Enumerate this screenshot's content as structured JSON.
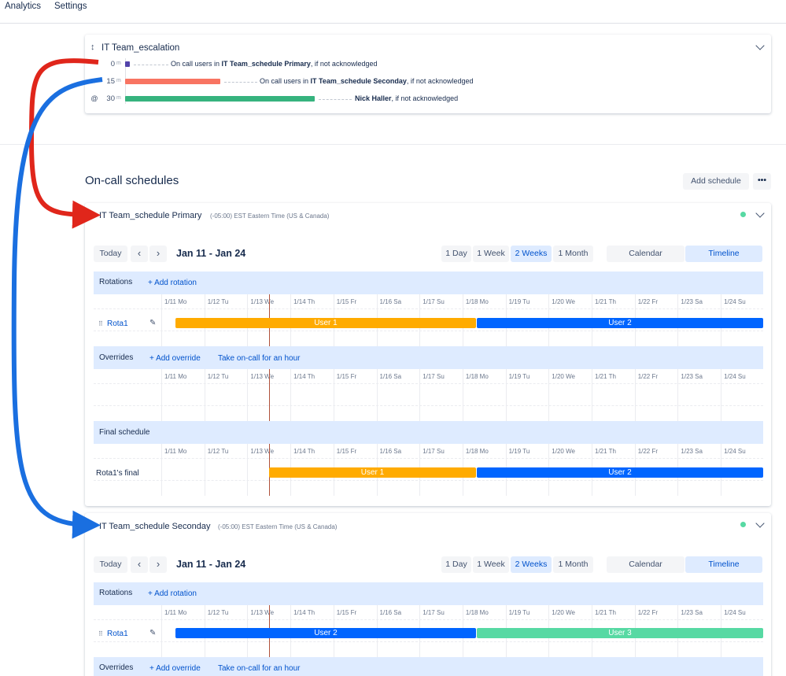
{
  "nav": {
    "items": [
      "Analytics",
      "Settings"
    ]
  },
  "escalation": {
    "title": "IT Team_escalation",
    "rows": [
      {
        "time": "0",
        "unit": "m",
        "bar_color": "#5243aa",
        "prefix": "On call users in ",
        "target": "IT Team_schedule Primary",
        "suffix": ", if not acknowledged"
      },
      {
        "time": "15",
        "unit": "m",
        "bar_color": "#f87462",
        "prefix": "On call users in ",
        "target": "IT Team_schedule Seconday",
        "suffix": ", if not acknowledged"
      },
      {
        "time": "30",
        "unit": "m",
        "bar_color": "#36b37e",
        "prefix": "",
        "target": "Nick Haller",
        "suffix": ", if not acknowledged"
      }
    ]
  },
  "schedules_section": {
    "title": "On-call schedules",
    "add_button": "Add schedule",
    "more_button": "•••"
  },
  "days": [
    "1/11 Mo",
    "1/12 Tu",
    "1/13 We",
    "1/14 Th",
    "1/15 Fr",
    "1/16 Sa",
    "1/17 Su",
    "1/18 Mo",
    "1/19 Tu",
    "1/20 We",
    "1/21 Th",
    "1/22 Fr",
    "1/23 Sa",
    "1/24 Su"
  ],
  "toolbar": {
    "today": "Today",
    "prev": "‹",
    "next": "›",
    "range": "Jan 11 - Jan 24",
    "views": [
      "1 Day",
      "1 Week",
      "2 Weeks",
      "1 Month"
    ],
    "active_view": "2 Weeks",
    "modes": [
      "Calendar",
      "Timeline"
    ],
    "active_mode": "Timeline"
  },
  "labels": {
    "rotations": "Rotations",
    "add_rotation": "+ Add rotation",
    "overrides": "Overrides",
    "add_override": "+ Add override",
    "take_oncall": "Take on-call for an hour",
    "final_schedule": "Final schedule"
  },
  "schedule_primary": {
    "name": "IT Team_schedule Primary",
    "timezone": "(-05:00) EST Eastern Time (US & Canada)",
    "rotation_name": "Rota1",
    "rotation_shifts": [
      {
        "label": "User 1",
        "color": "#ffab00"
      },
      {
        "label": "User 2",
        "color": "#0065ff"
      }
    ],
    "final_row": "Rota1's final",
    "final_shifts": [
      {
        "label": "User 1",
        "color": "#ffab00"
      },
      {
        "label": "User 2",
        "color": "#0065ff"
      }
    ]
  },
  "schedule_secondary": {
    "name": "IT Team_schedule Seconday",
    "timezone": "(-05:00) EST Eastern Time (US & Canada)",
    "rotation_name": "Rota1",
    "rotation_shifts": [
      {
        "label": "User 2",
        "color": "#0065ff"
      },
      {
        "label": "User 3",
        "color": "#57d9a3"
      }
    ]
  },
  "arrow_colors": {
    "red": "#e0261b",
    "blue": "#1a6fe0"
  }
}
